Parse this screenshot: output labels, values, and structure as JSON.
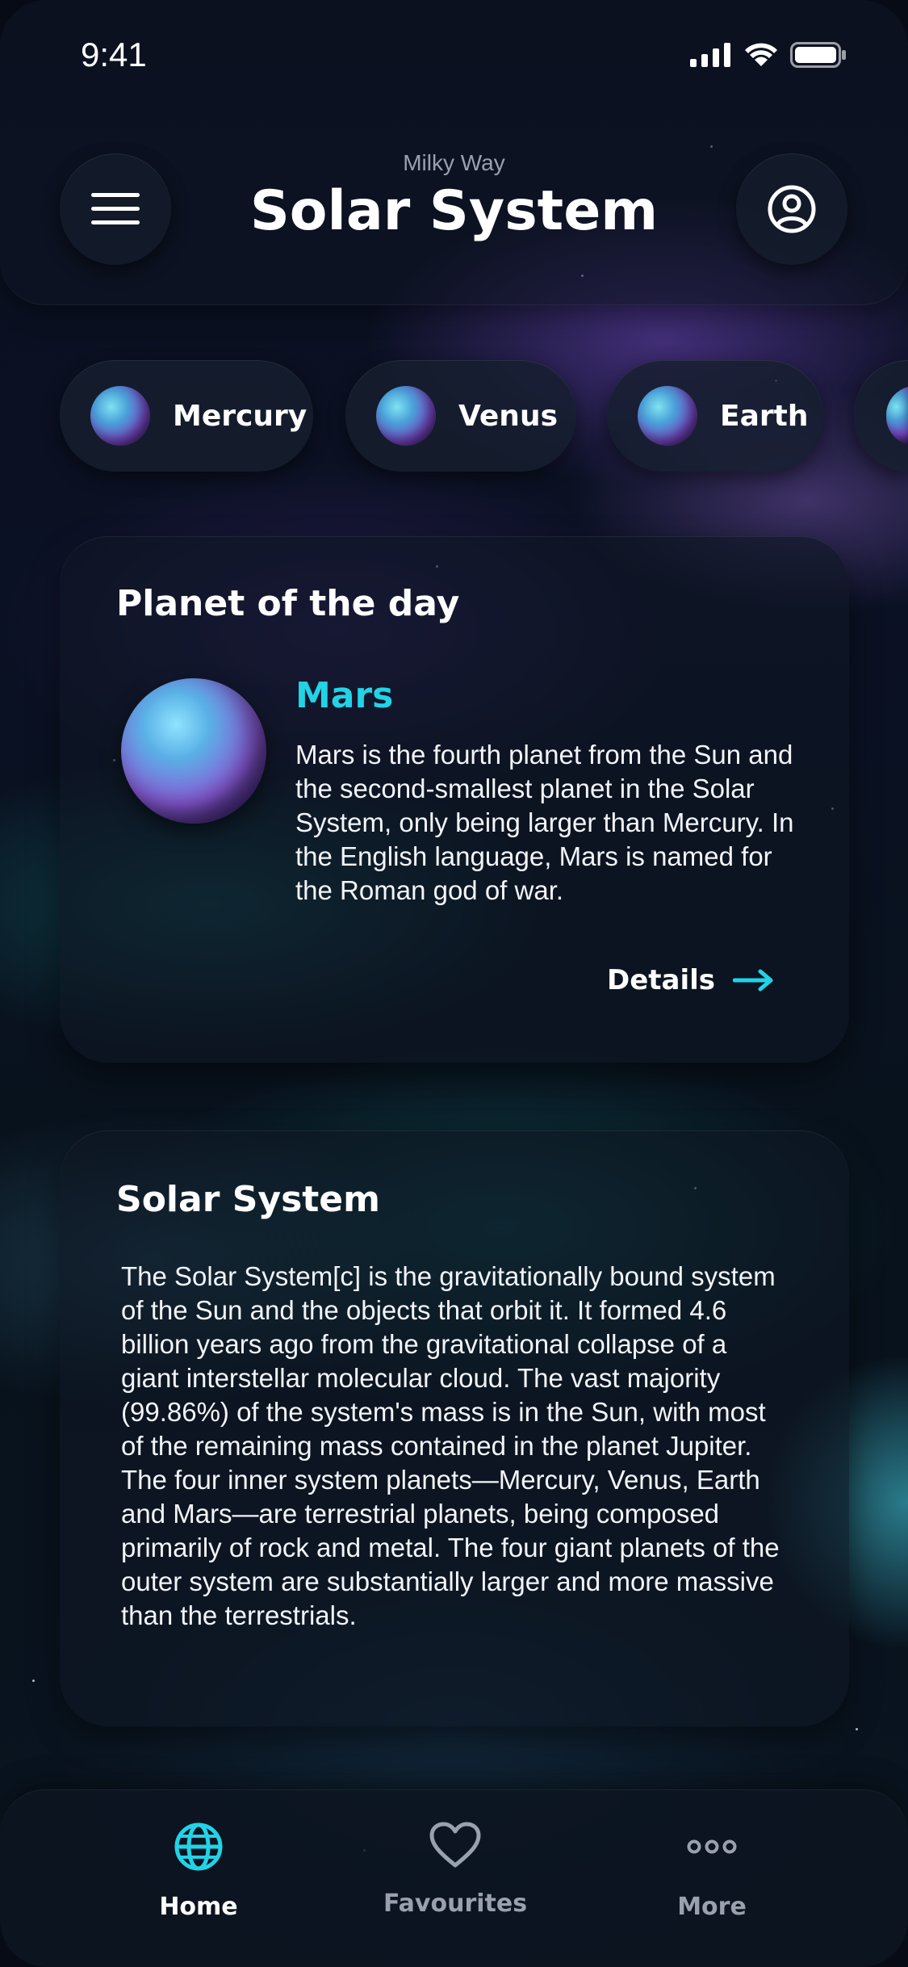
{
  "status_bar": {
    "time": "9:41"
  },
  "header": {
    "subtitle": "Milky Way",
    "title": "Solar System"
  },
  "planet_chips": [
    {
      "label": "Mercury"
    },
    {
      "label": "Venus"
    },
    {
      "label": "Earth"
    }
  ],
  "planet_of_day": {
    "heading": "Planet of the day",
    "name": "Mars",
    "description": "Mars is the fourth planet from the Sun and the second-smallest planet in the Solar System, only being larger than Mercury. In the English language, Mars is named for the Roman god of war.",
    "details_label": "Details"
  },
  "solar_system": {
    "heading": "Solar System",
    "description": "The Solar System[c] is the gravitationally bound system of the Sun and the objects that orbit it. It formed 4.6 billion years ago from the gravitational collapse of a giant interstellar molecular cloud. The vast majority (99.86%) of the system's mass is in the Sun, with most of the remaining mass contained in the planet Jupiter. The four inner system planets—Mercury, Venus, Earth and Mars—are terrestrial planets, being composed primarily of rock and metal. The four giant planets of the outer system are substantially larger and more massive than the terrestrials."
  },
  "tabbar": {
    "tabs": [
      {
        "label": "Home",
        "icon": "globe-icon",
        "active": true
      },
      {
        "label": "Favourites",
        "icon": "heart-icon",
        "active": false
      },
      {
        "label": "More",
        "icon": "more-dots-icon",
        "active": false
      }
    ]
  },
  "colors": {
    "accent": "#22d3e6",
    "inactive": "#9aa0ad"
  }
}
